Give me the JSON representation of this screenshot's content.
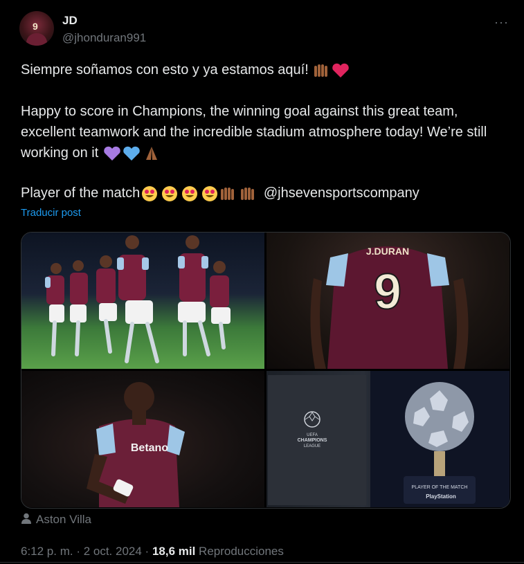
{
  "author": {
    "name": "JD",
    "handle": "@jhonduran991",
    "avatar_number": "9"
  },
  "more_label": "···",
  "post": {
    "line1": "Siempre soñamos con esto y ya estamos aquí!",
    "para2": "Happy to score in Champions, the winning goal against this great team, excellent teamwork and the incredible stadium atmosphere today! We’re still working on it",
    "line4_text": "Player of the match",
    "line4_mention": "@jhsevensportscompany"
  },
  "translate_label": "Traducir post",
  "photos": {
    "jersey_name": "J.DURAN",
    "jersey_number": "9",
    "sponsor": "Betano",
    "ucl_line1": "UEFA",
    "ucl_line2": "CHAMPIONS",
    "ucl_line3": "LEAGUE",
    "trophy_line1": "PLAYER OF THE MATCH",
    "trophy_line2": "PlayStation"
  },
  "location": "Aston Villa",
  "meta": {
    "time": "6:12 p. m. · 2 oct. 2024 · ",
    "views": "18,6 mil",
    "views_label": " Reproducciones"
  },
  "colors": {
    "link": "#1d9bf0",
    "muted": "#71767b",
    "text": "#e7e9ea",
    "bg": "#000000"
  }
}
